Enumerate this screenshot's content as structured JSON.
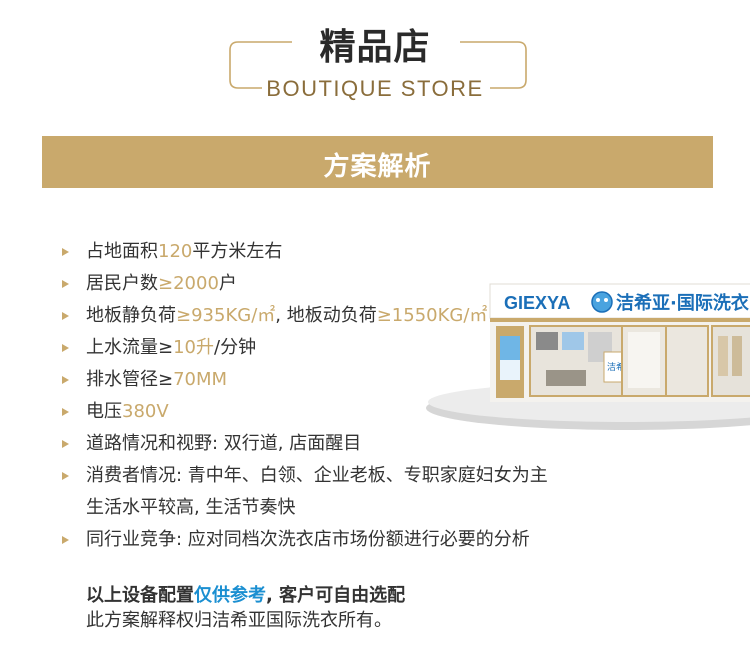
{
  "header": {
    "title_zh": "精品店",
    "title_en": "BOUTIQUE STORE"
  },
  "banner": {
    "text": "方案解析"
  },
  "bullets": [
    {
      "parts": [
        {
          "t": "占地面积"
        },
        {
          "t": "120",
          "hl": true
        },
        {
          "t": "平方米左右"
        }
      ]
    },
    {
      "parts": [
        {
          "t": "居民户数"
        },
        {
          "t": "≥2000",
          "hl": true
        },
        {
          "t": "户"
        }
      ]
    },
    {
      "parts": [
        {
          "t": "地板静负荷"
        },
        {
          "t": "≥935KG/㎡",
          "hl": true
        },
        {
          "t": ", 地板动负荷"
        },
        {
          "t": "≥1550KG/㎡",
          "hl": true
        }
      ]
    },
    {
      "parts": [
        {
          "t": "上水流量≥"
        },
        {
          "t": "10升",
          "hl": true
        },
        {
          "t": "/分钟"
        }
      ]
    },
    {
      "parts": [
        {
          "t": "排水管径≥"
        },
        {
          "t": "70MM",
          "hl": true
        }
      ]
    },
    {
      "parts": [
        {
          "t": "电压"
        },
        {
          "t": "380V",
          "hl": true
        }
      ]
    },
    {
      "parts": [
        {
          "t": "道路情况和视野: 双行道, 店面醒目"
        }
      ]
    },
    {
      "parts": [
        {
          "t": "消费者情况: 青中年、白领、企业老板、专职家庭妇女为主"
        }
      ],
      "continuation": "生活水平较高, 生活节奏快"
    },
    {
      "parts": [
        {
          "t": "同行业竞争: 应对同档次洗衣店市场份额进行必要的分析"
        }
      ]
    }
  ],
  "footer": {
    "line1_a": "以上设备配置",
    "line1_b": "仅供参考",
    "line1_c": ", 客户可自由选配",
    "line2": "此方案解释权归洁希亚国际洗衣所有。"
  },
  "store_image": {
    "brand_en": "GIEXYA",
    "brand_zh": "洁希亚·国际洗衣",
    "inner_sign": "洁希亚"
  },
  "colors": {
    "gold": "#c9a96c",
    "blue": "#1b8fd1",
    "text": "#333333"
  }
}
